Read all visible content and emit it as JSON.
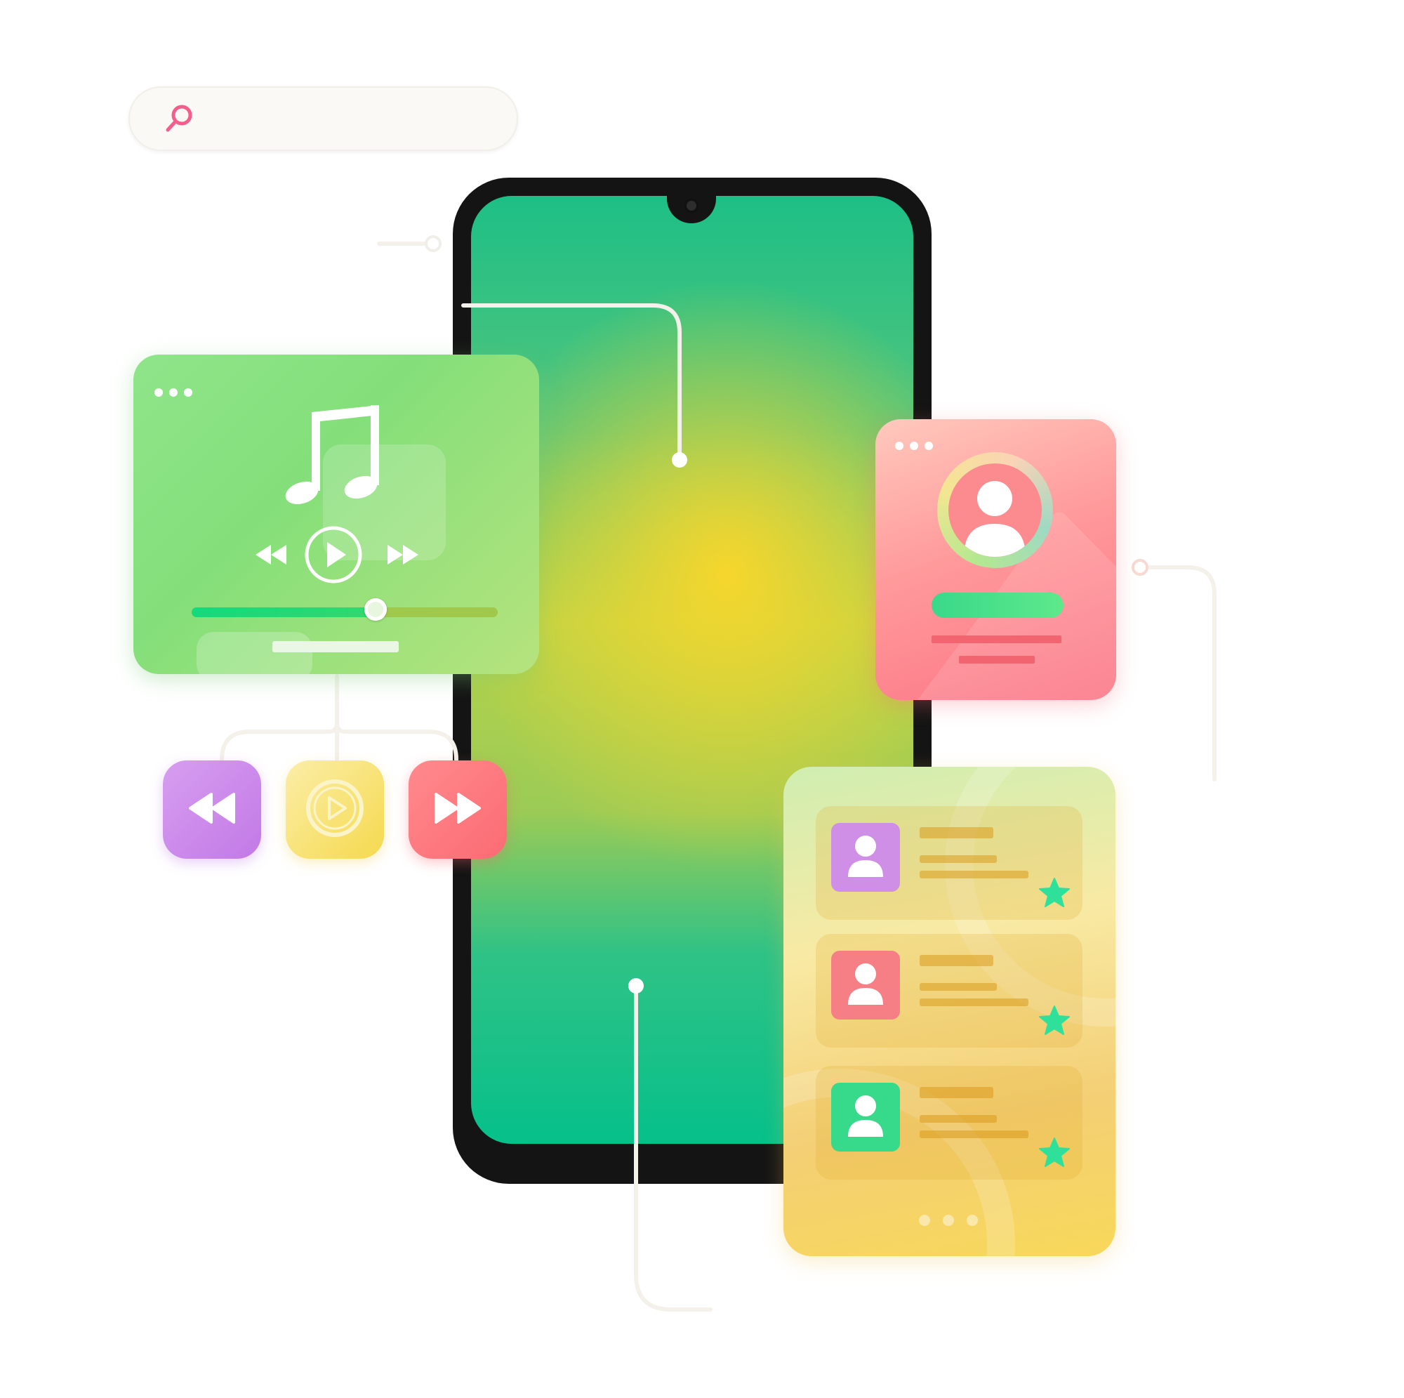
{
  "search": {
    "placeholder": "",
    "value": "",
    "icon": "search-icon"
  },
  "music_player": {
    "menu_icon": "more-dots-icon",
    "note_icon": "music-note-icon",
    "controls": [
      "rewind-icon",
      "play-icon",
      "fast-forward-icon"
    ],
    "progress": 0.6
  },
  "media_buttons": [
    {
      "icon": "rewind-icon",
      "color": "#c981ea"
    },
    {
      "icon": "play-icon",
      "color": "#f7e170"
    },
    {
      "icon": "fast-forward-icon",
      "color": "#fc7479"
    }
  ],
  "profile_card": {
    "menu_icon": "more-dots-icon",
    "avatar_icon": "user-icon"
  },
  "contacts": [
    {
      "avatar_color": "#cf8fe6",
      "favorite": true
    },
    {
      "avatar_color": "#f67f86",
      "favorite": true
    },
    {
      "avatar_color": "#37d98a",
      "favorite": true
    }
  ],
  "contacts_pager": {
    "pages": 3
  },
  "colors": {
    "accent_green": "#1fc88a",
    "accent_pink": "#f45e8a",
    "accent_yellow": "#f6d62c",
    "star": "#2fe09a"
  }
}
